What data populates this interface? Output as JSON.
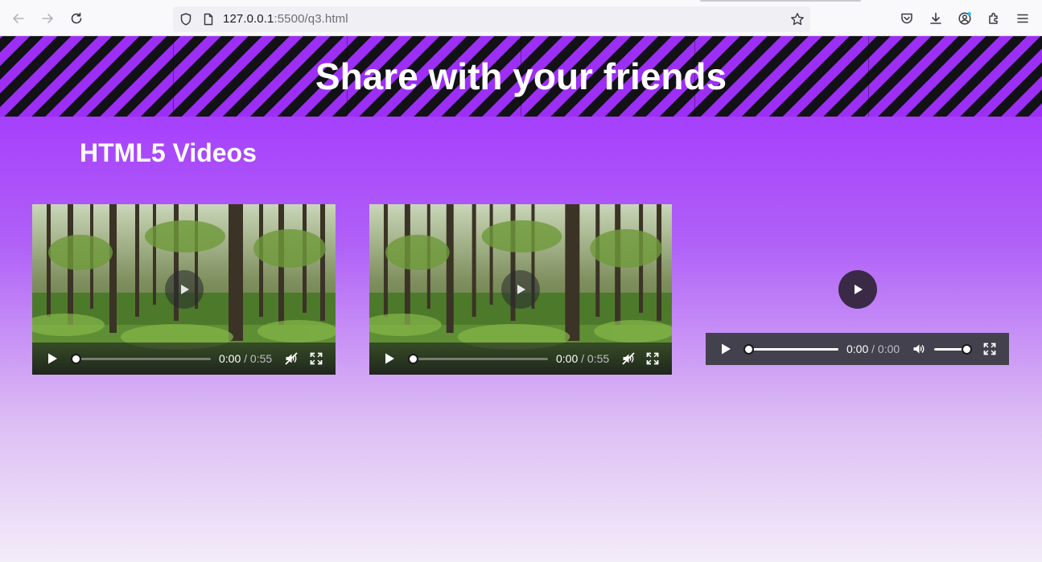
{
  "browser": {
    "url_host": "127.0.0.1",
    "url_rest": ":5500/q3.html",
    "icons": [
      "back-arrow-icon",
      "forward-arrow-icon",
      "reload-icon",
      "shield-icon",
      "page-icon",
      "star-icon",
      "pocket-icon",
      "download-icon",
      "account-icon",
      "extensions-icon",
      "menu-icon"
    ]
  },
  "page": {
    "banner_title": "Share with your friends",
    "section_title": "HTML5 Videos"
  },
  "videos": [
    {
      "current_time": "0:00",
      "duration_sep": " / ",
      "duration": "0:55",
      "progress": 0,
      "muted": true
    },
    {
      "current_time": "0:00",
      "duration_sep": " / ",
      "duration": "0:55",
      "progress": 0,
      "muted": true
    }
  ],
  "audio": {
    "current_time": "0:00",
    "duration_sep": " / ",
    "duration": "0:00",
    "progress": 0,
    "volume": 1.0
  },
  "colors": {
    "accent": "#a02bff",
    "stripe_dark": "#111116",
    "stripe_light": "#9c2ef5"
  }
}
